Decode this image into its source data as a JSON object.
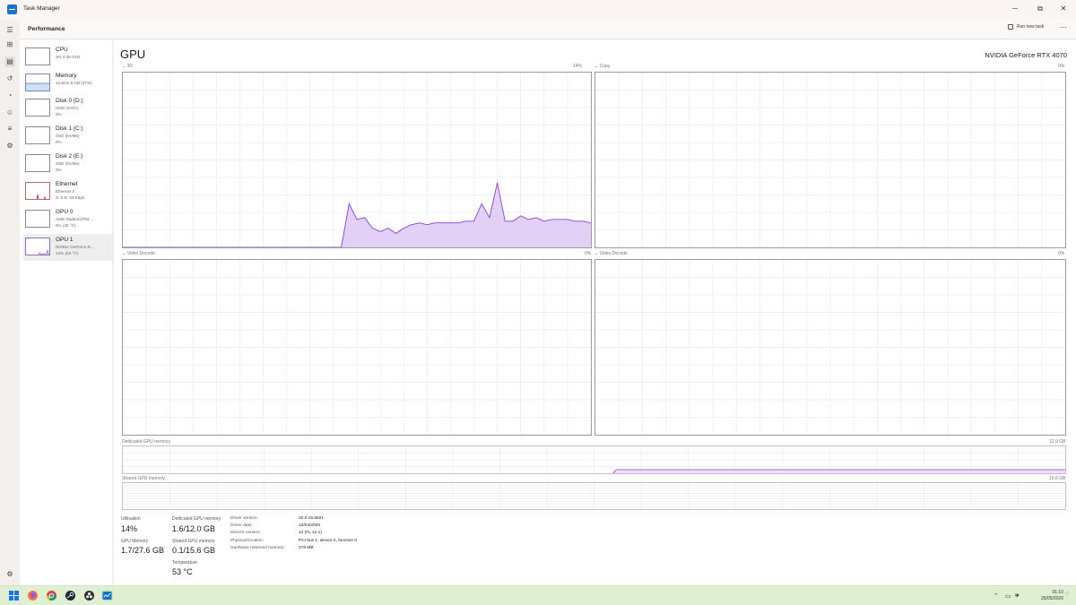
{
  "window": {
    "title": "Task Manager",
    "controls": {
      "minimize": "─",
      "maximize": "⧉",
      "close": "✕"
    }
  },
  "header": {
    "title": "Performance",
    "run_new_task": "Run new task",
    "more": "⋯"
  },
  "rail": {
    "icons": [
      "menu-icon",
      "processes-icon",
      "performance-icon",
      "app-history-icon",
      "startup-apps-icon",
      "users-icon",
      "details-icon",
      "services-icon",
      "settings-icon"
    ]
  },
  "sidebar": {
    "items": [
      {
        "name": "CPU",
        "line1": "3%  4.48 GHz",
        "line2": ""
      },
      {
        "name": "Memory",
        "line1": "14.8/31.6 GB (47%)",
        "line2": ""
      },
      {
        "name": "Disk 0 (D:)",
        "line1": "HDD (SATA)",
        "line2": "0%"
      },
      {
        "name": "Disk 1 (C:)",
        "line1": "SSD (NVMe)",
        "line2": "0%"
      },
      {
        "name": "Disk 2 (E:)",
        "line1": "SSD (NVMe)",
        "line2": "0%"
      },
      {
        "name": "Ethernet",
        "line1": "Ethernet 2",
        "line2": "S: 0  R: 64 Kbps"
      },
      {
        "name": "GPU 0",
        "line1": "AMD Radeon(TM) ...",
        "line2": "0% (42 °C)"
      },
      {
        "name": "GPU 1",
        "line1": "NVIDIA GeForce R...",
        "line2": "14% (53 °C)"
      }
    ]
  },
  "main": {
    "title": "GPU",
    "model": "NVIDIA GeForce RTX 4070",
    "panels": [
      {
        "label": "3D",
        "value": "14%"
      },
      {
        "label": "Copy",
        "value": "0%"
      },
      {
        "label": "Video Decode",
        "value": "0%"
      },
      {
        "label": "Video Decode",
        "value": "0%"
      }
    ],
    "dedicated_label": "Dedicated GPU memory",
    "dedicated_max": "12.0 GB",
    "shared_label": "Shared GPU memory",
    "shared_max": "15.6 GB",
    "stats": {
      "utilisation_label": "Utilisation",
      "utilisation": "14%",
      "gpu_memory_label": "GPU Memory",
      "gpu_memory": "1.7/27.6 GB",
      "dedicated_label": "Dedicated GPU memory",
      "dedicated": "1.6/12.0 GB",
      "shared_label": "Shared GPU memory",
      "shared": "0.1/15.6 GB",
      "temperature_label": "Temperature",
      "temperature": "53 °C"
    },
    "info": [
      {
        "label": "Driver version:",
        "value": "32.0.15.6621"
      },
      {
        "label": "Driver date:",
        "value": "10/04/2026"
      },
      {
        "label": "DirectX version:",
        "value": "12 (FL 12.1)"
      },
      {
        "label": "Physical location:",
        "value": "PCI bus 1, device 0, function 0"
      },
      {
        "label": "Hardware reserved memory:",
        "value": "278 MB"
      }
    ]
  },
  "chart_data": {
    "type": "area",
    "title": "3D",
    "ylim": [
      0,
      100
    ],
    "xlim": [
      0,
      60
    ],
    "series": [
      {
        "name": "3D",
        "x": [
          0,
          28,
          29,
          30,
          31,
          32,
          33,
          34,
          35,
          36,
          37,
          38,
          39,
          40,
          41,
          42,
          43,
          44,
          45,
          46,
          47,
          48,
          49,
          50,
          51,
          52,
          53,
          54,
          55,
          56,
          57,
          58,
          59,
          60
        ],
        "values": [
          0,
          0,
          25,
          16,
          17,
          11,
          9,
          11,
          8,
          11,
          13,
          14,
          13,
          14,
          14,
          14,
          14,
          15,
          15,
          25,
          17,
          37,
          15,
          15,
          18,
          16,
          17,
          15,
          16,
          16,
          16,
          15,
          15,
          14
        ]
      }
    ],
    "dedicated_memory_gb": {
      "max": 12.0,
      "used": 1.6
    },
    "shared_memory_gb": {
      "max": 15.6,
      "used": 0.1
    }
  },
  "taskbar": {
    "apps": [
      "windows-start-icon",
      "firefox-icon",
      "chrome-icon",
      "steam-icon",
      "obs-icon",
      "task-manager-icon"
    ],
    "clock_time": "01:10",
    "clock_date": "25/05/2026"
  }
}
